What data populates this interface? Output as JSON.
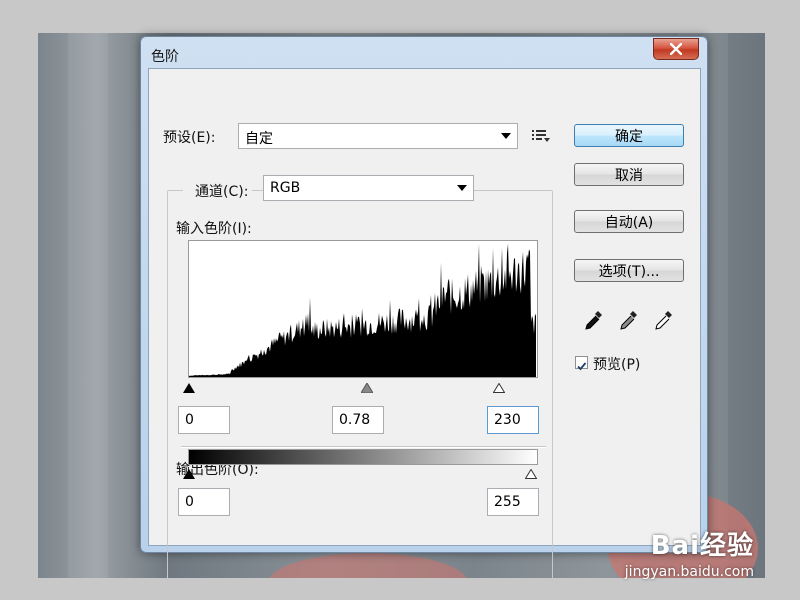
{
  "window": {
    "title": "色阶"
  },
  "preset": {
    "label": "预设(E):",
    "value": "自定"
  },
  "channel": {
    "label": "通道(C):",
    "value": "RGB"
  },
  "input_levels": {
    "label": "输入色阶(I):",
    "black": "0",
    "gamma": "0.78",
    "white": "230"
  },
  "output_levels": {
    "label": "输出色阶(O):",
    "black": "0",
    "white": "255"
  },
  "buttons": {
    "ok": "确定",
    "cancel": "取消",
    "auto": "自动(A)",
    "options": "选项(T)..."
  },
  "preview": {
    "label": "预览(P)",
    "checked": true
  },
  "watermark": {
    "brand": "Bai经验",
    "url": "jingyan.baidu.com"
  },
  "icons": {
    "close": "close-icon",
    "preset_menu": "preset-menu-icon",
    "black_eyedropper": "black-eyedropper-icon",
    "gray_eyedropper": "gray-eyedropper-icon",
    "white_eyedropper": "white-eyedropper-icon"
  }
}
